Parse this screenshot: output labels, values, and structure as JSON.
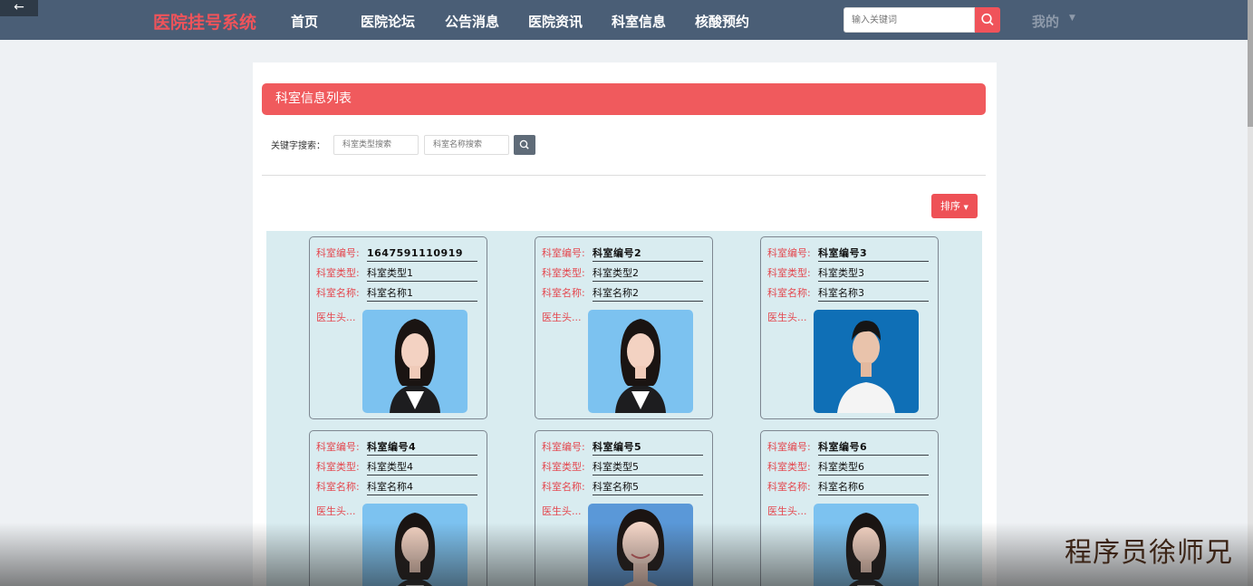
{
  "nav": {
    "back_icon": "arrow-left-icon",
    "brand": "医院挂号系统",
    "items": [
      "首页",
      "医院论坛",
      "公告消息",
      "医院资讯",
      "科室信息",
      "核酸预约"
    ],
    "search_placeholder": "输入关键词",
    "user_menu": "我的"
  },
  "panel": {
    "title": "科室信息列表",
    "keyword_label": "关键字搜索：",
    "filters": [
      {
        "placeholder": "科室类型搜索"
      },
      {
        "placeholder": "科室名称搜索"
      }
    ],
    "sort_label": "排序"
  },
  "field_labels": {
    "code": "科室编号:",
    "type": "科室类型:",
    "name": "科室名称:",
    "photo": "医生头..."
  },
  "cards": [
    {
      "code": "1647591110919",
      "type": "科室类型1",
      "name": "科室名称1",
      "photo": "female-portrait"
    },
    {
      "code": "科室编号2",
      "type": "科室类型2",
      "name": "科室名称2",
      "photo": "female-portrait"
    },
    {
      "code": "科室编号3",
      "type": "科室类型3",
      "name": "科室名称3",
      "photo": "male-portrait"
    },
    {
      "code": "科室编号4",
      "type": "科室类型4",
      "name": "科室名称4",
      "photo": "female-portrait"
    },
    {
      "code": "科室编号5",
      "type": "科室类型5",
      "name": "科室名称5",
      "photo": "female-portrait-smiling"
    },
    {
      "code": "科室编号6",
      "type": "科室类型6",
      "name": "科室名称6",
      "photo": "female-portrait"
    }
  ],
  "watermark": "程序员徐师兄",
  "colors": {
    "nav_bg": "#4a5e76",
    "brand": "#f0535a",
    "accent": "#f05a5d",
    "grid_bg": "#d9ecf0",
    "label_red": "#e4484f"
  }
}
